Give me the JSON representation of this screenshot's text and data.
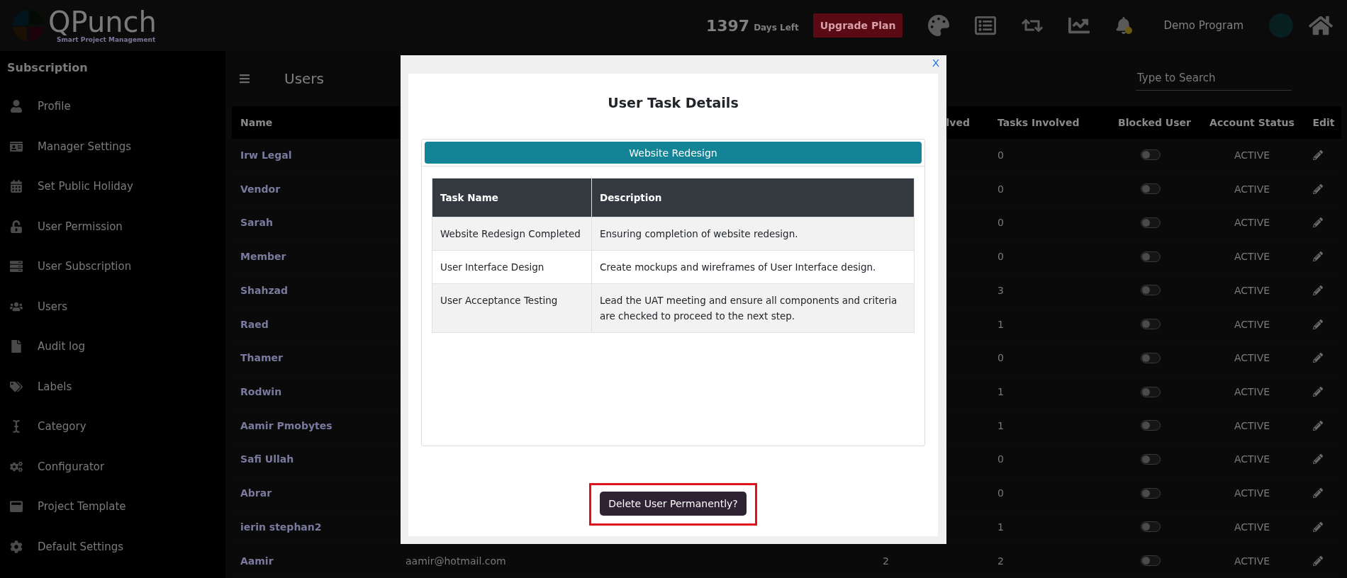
{
  "header": {
    "logo": {
      "name": "QPunch",
      "tagline": "Smart Project Management"
    },
    "days_left": {
      "count": "1397",
      "label": "Days Left"
    },
    "upgrade_button": "Upgrade Plan",
    "program_name": "Demo Program"
  },
  "sidebar": {
    "title": "Subscription",
    "items": [
      {
        "label": "Profile"
      },
      {
        "label": "Manager Settings"
      },
      {
        "label": "Set Public Holiday"
      },
      {
        "label": "User Permission"
      },
      {
        "label": "User Subscription"
      },
      {
        "label": "Users"
      },
      {
        "label": "Audit log"
      },
      {
        "label": "Labels"
      },
      {
        "label": "Category"
      },
      {
        "label": "Configurator"
      },
      {
        "label": "Project Template"
      },
      {
        "label": "Default Settings"
      }
    ]
  },
  "main": {
    "title": "Users",
    "search": {
      "placeholder": "Type to Search"
    }
  },
  "table": {
    "columns": [
      {
        "label": "Name"
      },
      {
        "label": "lved"
      },
      {
        "label": "Tasks Involved"
      },
      {
        "label": "Blocked User"
      },
      {
        "label": "Account Status"
      },
      {
        "label": "Edit"
      }
    ],
    "rows": [
      {
        "name": "Irw Legal",
        "tasks": "0",
        "blocked": false,
        "status": "ACTIVE"
      },
      {
        "name": "Vendor",
        "tasks": "0",
        "blocked": false,
        "status": "ACTIVE"
      },
      {
        "name": "Sarah",
        "tasks": "0",
        "blocked": false,
        "status": "ACTIVE"
      },
      {
        "name": "Member",
        "tasks": "0",
        "blocked": false,
        "status": "ACTIVE"
      },
      {
        "name": "Shahzad",
        "tasks": "3",
        "blocked": false,
        "status": "ACTIVE"
      },
      {
        "name": "Raed",
        "tasks": "1",
        "blocked": false,
        "status": "ACTIVE"
      },
      {
        "name": "Thamer",
        "tasks": "0",
        "blocked": false,
        "status": "ACTIVE"
      },
      {
        "name": "Rodwin",
        "tasks": "1",
        "blocked": false,
        "status": "ACTIVE"
      },
      {
        "name": "Aamir Pmobytes",
        "tasks": "1",
        "blocked": false,
        "status": "ACTIVE"
      },
      {
        "name": "Safi Ullah",
        "tasks": "0",
        "blocked": false,
        "status": "ACTIVE"
      },
      {
        "name": "Abrar",
        "tasks": "0",
        "blocked": false,
        "status": "ACTIVE"
      },
      {
        "name": "ierin stephan2",
        "tasks": "1",
        "blocked": false,
        "status": "ACTIVE"
      },
      {
        "name": "Aamir",
        "email": "aamir@hotmail.com",
        "projects": "2",
        "tasks": "2",
        "blocked": false,
        "status": "ACTIVE"
      }
    ]
  },
  "modal": {
    "close": "X",
    "title": "User Task Details",
    "project": "Website Redesign",
    "task_table": {
      "columns": [
        "Task Name",
        "Description"
      ],
      "rows": [
        {
          "task": "Website Redesign Completed",
          "description": "Ensuring completion of website redesign."
        },
        {
          "task": "User Interface Design",
          "description": "Create mockups and wireframes of User Interface design."
        },
        {
          "task": "User Acceptance Testing",
          "description": "Lead the UAT meeting and ensure all components and criteria are checked to proceed to the next step."
        }
      ]
    },
    "delete_button": {
      "label": "Delete User Permanently?",
      "highlighted": true
    }
  }
}
